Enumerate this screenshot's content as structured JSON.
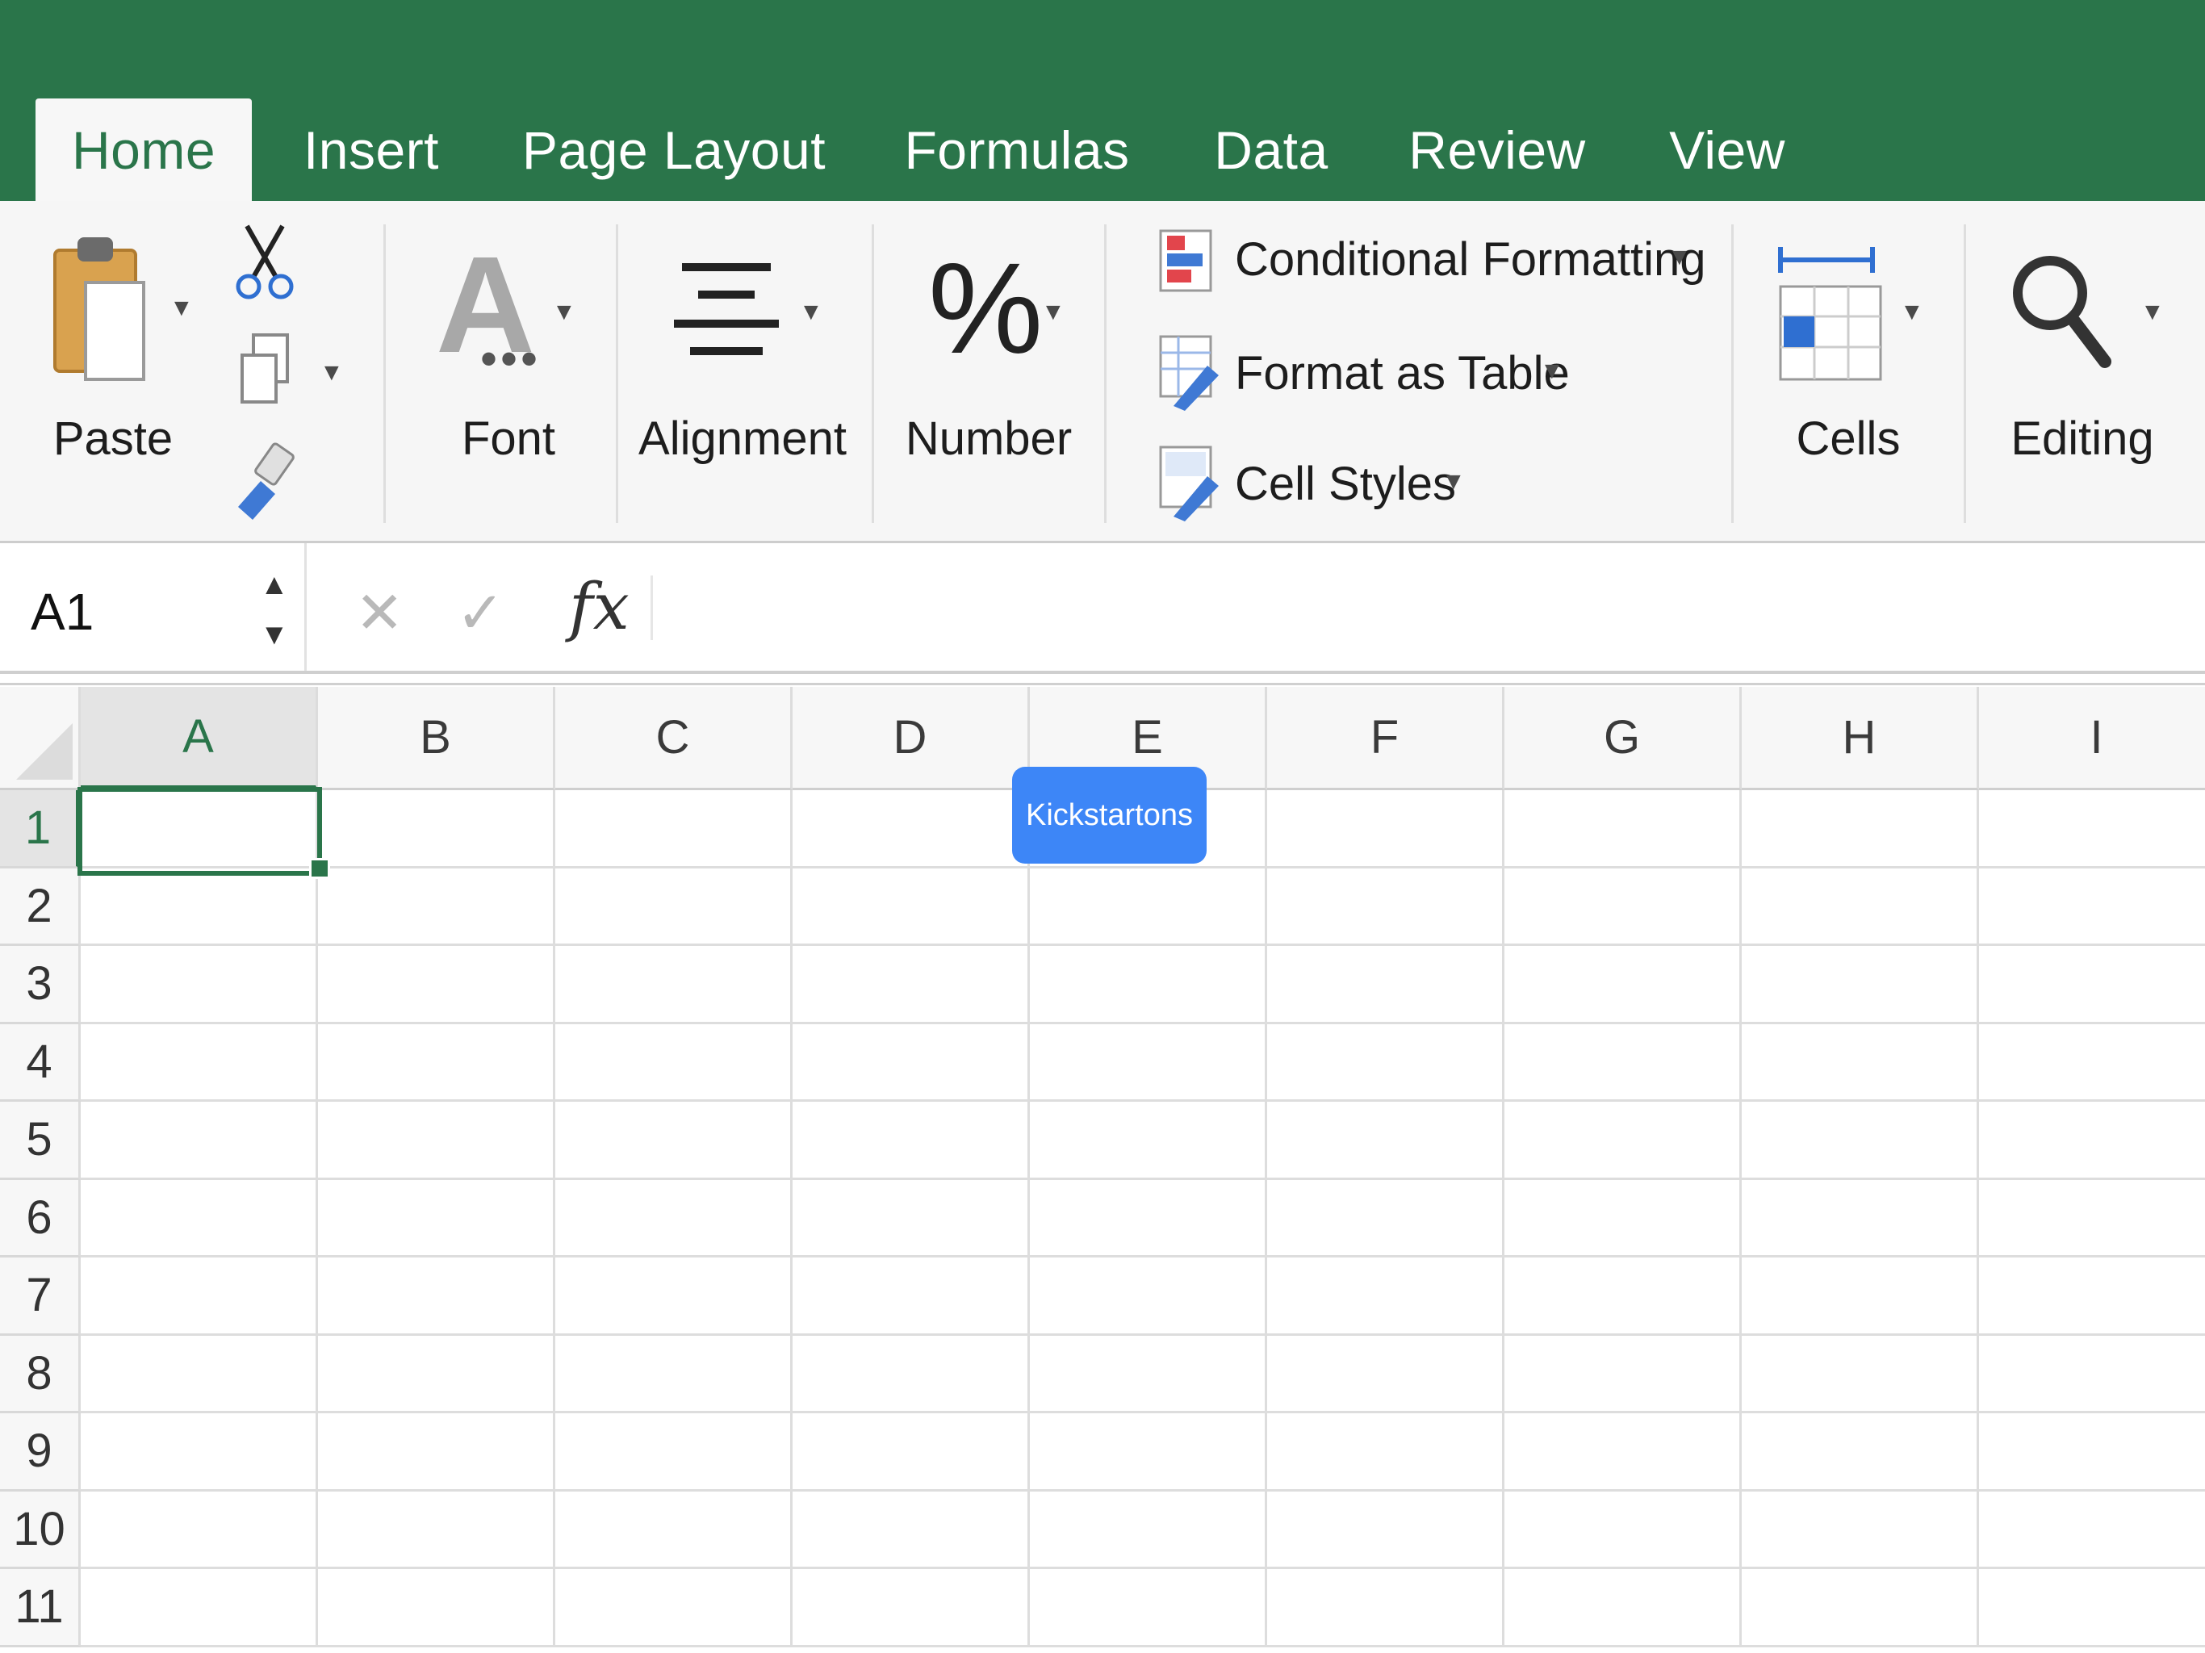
{
  "tabs": [
    {
      "label": "Home",
      "active": true
    },
    {
      "label": "Insert"
    },
    {
      "label": "Page Layout"
    },
    {
      "label": "Formulas"
    },
    {
      "label": "Data"
    },
    {
      "label": "Review"
    },
    {
      "label": "View"
    }
  ],
  "ribbon": {
    "paste_label": "Paste",
    "font_label": "Font",
    "font_glyph": "A",
    "alignment_label": "Alignment",
    "number_label": "Number",
    "number_glyph": "%",
    "conditional_formatting": "Conditional Formatting",
    "format_as_table": "Format as Table",
    "cell_styles": "Cell Styles",
    "cells_label": "Cells",
    "editing_label": "Editing"
  },
  "formula_bar": {
    "name_box": "A1",
    "cancel_symbol": "✕",
    "enter_symbol": "✓",
    "fx_label": "fx",
    "value": ""
  },
  "sheet": {
    "columns": [
      "A",
      "B",
      "C",
      "D",
      "E",
      "F",
      "G",
      "H",
      "I"
    ],
    "rows": [
      "1",
      "2",
      "3",
      "4",
      "5",
      "6",
      "7",
      "8",
      "9",
      "10",
      "11"
    ],
    "selected_cell": "A1"
  },
  "overlay_badge": "Kickstartons",
  "colors": {
    "accent": "#2a754a",
    "badge": "#3d86f7"
  }
}
